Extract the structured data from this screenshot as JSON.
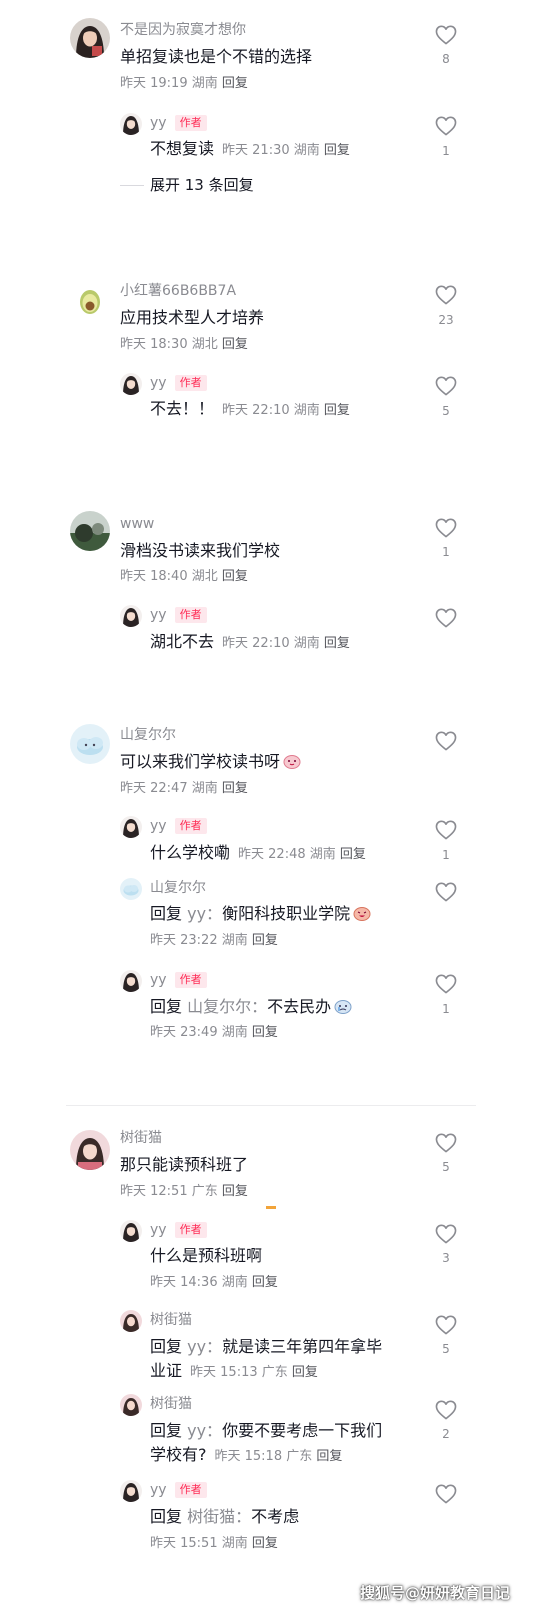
{
  "colors": {
    "author_tag": "#fe2c55",
    "muted_text": "#8a8b91",
    "body_text": "#161823",
    "divider": "#ececee"
  },
  "icons": {
    "like": "heart-outline-icon"
  },
  "threads": [
    {
      "name": "不是因为寂寞才想你",
      "text": "单招复读也是个不错的选择",
      "time": "昨天 19:19",
      "location": "湖南",
      "reply": "回复",
      "likes": "8",
      "replies": [
        {
          "name": "yy",
          "author_tag": "作者",
          "text": "不想复读",
          "time": "昨天 21:30",
          "location": "湖南",
          "reply": "回复",
          "likes": "1"
        }
      ],
      "expand": "展开 13 条回复"
    },
    {
      "name": "小红薯66B6BB7A",
      "text": "应用技术型人才培养",
      "time": "昨天 18:30",
      "location": "湖北",
      "reply": "回复",
      "likes": "23",
      "replies": [
        {
          "name": "yy",
          "author_tag": "作者",
          "text": "不去！！",
          "time": "昨天 22:10",
          "location": "湖南",
          "reply": "回复",
          "likes": "5"
        }
      ]
    },
    {
      "name": "www",
      "text": "滑档没书读来我们学校",
      "time": "昨天 18:40",
      "location": "湖北",
      "reply": "回复",
      "likes": "1",
      "replies": [
        {
          "name": "yy",
          "author_tag": "作者",
          "text": "湖北不去",
          "time": "昨天 22:10",
          "location": "湖南",
          "reply": "回复",
          "likes": ""
        }
      ]
    },
    {
      "name": "山复尔尔",
      "text": "可以来我们学校读书呀",
      "time": "昨天 22:47",
      "location": "湖南",
      "reply": "回复",
      "likes": "",
      "replies": [
        {
          "name": "yy",
          "author_tag": "作者",
          "text": "什么学校嘞",
          "time": "昨天 22:48",
          "location": "湖南",
          "reply": "回复",
          "likes": "1"
        },
        {
          "name": "山复尔尔",
          "prefix": "回复",
          "target": "yy：",
          "text": "衡阳科技职业学院",
          "time": "昨天 23:22",
          "location": "湖南",
          "reply": "回复",
          "likes": ""
        },
        {
          "name": "yy",
          "author_tag": "作者",
          "prefix": "回复",
          "target": "山复尔尔：",
          "text": "不去民办",
          "time": "昨天 23:49",
          "location": "湖南",
          "reply": "回复",
          "likes": "1"
        }
      ]
    },
    {
      "name": "树街猫",
      "text": "那只能读预科班了",
      "time": "昨天 12:51",
      "location": "广东",
      "reply": "回复",
      "likes": "5",
      "replies": [
        {
          "name": "yy",
          "author_tag": "作者",
          "text": "什么是预科班啊",
          "time": "昨天 14:36",
          "location": "湖南",
          "reply": "回复",
          "likes": "3"
        },
        {
          "name": "树街猫",
          "prefix": "回复",
          "target": "yy：",
          "text": "就是读三年第四年拿毕",
          "text2": "业证",
          "time": "昨天 15:13",
          "location": "广东",
          "reply": "回复",
          "likes": "5"
        },
        {
          "name": "树街猫",
          "prefix": "回复",
          "target": "yy：",
          "text": "你要不要考虑一下我们",
          "text2": "学校有?",
          "time": "昨天 15:18",
          "location": "广东",
          "reply": "回复",
          "likes": "2"
        },
        {
          "name": "yy",
          "author_tag": "作者",
          "prefix": "回复",
          "target": "树街猫：",
          "text": "不考虑",
          "time": "昨天 15:51",
          "location": "湖南",
          "reply": "回复",
          "likes": ""
        }
      ]
    }
  ],
  "watermark": "搜狐号@妍妍教育日记"
}
